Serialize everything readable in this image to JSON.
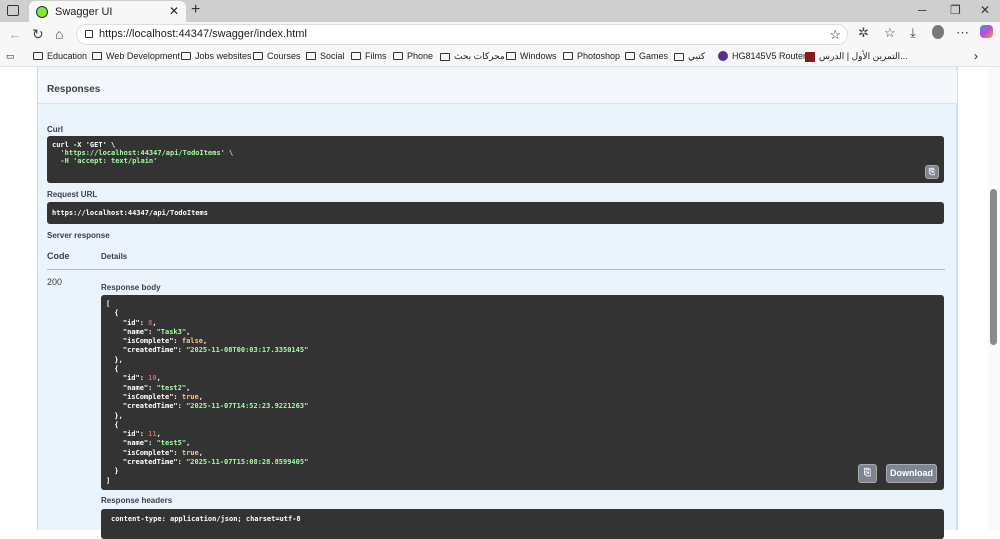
{
  "browser": {
    "tab_title": "Swagger UI",
    "url": "https://localhost:44347/swagger/index.html",
    "bookmarks": [
      "Education",
      "Web Development",
      "Jobs websites",
      "Courses",
      "Social",
      "Films",
      "Phone",
      "محركات بحث",
      "Windows",
      "Photoshop",
      "Games",
      "كتبي",
      "HG8145V5 Router",
      "التمرين الأول | الدرس..."
    ]
  },
  "page": {
    "responses_title": "Responses",
    "curl_label": "Curl",
    "curl_lines": [
      "curl -X 'GET' \\",
      "  'https://localhost:44347/api/TodoItems' \\",
      "  -H 'accept: text/plain'"
    ],
    "request_url_label": "Request URL",
    "request_url": "https://localhost:44347/api/TodoItems",
    "server_response_label": "Server response",
    "code_header": "Code",
    "details_header": "Details",
    "status_code": "200",
    "response_body_label": "Response body",
    "items": [
      {
        "id": "8",
        "name": "\"Task3\"",
        "isComplete": "false",
        "createdTime": "\"2025-11-08T00:03:17.3350145\""
      },
      {
        "id": "10",
        "name": "\"test2\"",
        "isComplete": "true",
        "createdTime": "\"2025-11-07T14:52:23.9221263\""
      },
      {
        "id": "11",
        "name": "\"test5\"",
        "isComplete": "true",
        "createdTime": "\"2025-11-07T15:08:28.8599405\""
      }
    ],
    "download_label": "Download",
    "response_headers_label": "Response headers",
    "header_line": "content-type: application/json; charset=utf-8"
  }
}
